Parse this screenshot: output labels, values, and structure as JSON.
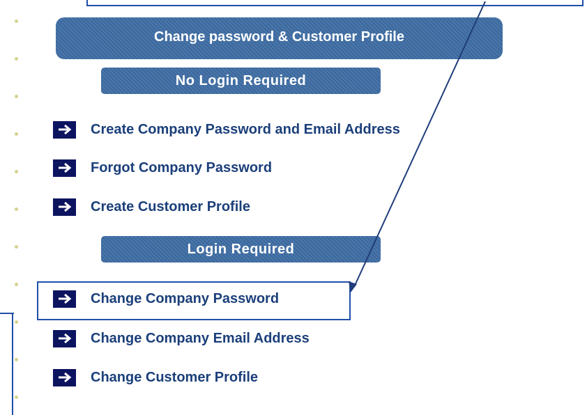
{
  "header": {
    "title": "Change password & Customer Profile"
  },
  "sections": {
    "no_login": "No Login Required",
    "login": "Login Required"
  },
  "no_login_links": [
    {
      "label": "Create Company Password and Email Address",
      "icon": "arrow-right-icon"
    },
    {
      "label": "Forgot Company Password",
      "icon": "arrow-right-icon"
    },
    {
      "label": "Create Customer Profile",
      "icon": "arrow-right-icon"
    }
  ],
  "login_links": [
    {
      "label": "Change Company Password",
      "icon": "arrow-right-icon",
      "highlighted": true
    },
    {
      "label": "Change Company Email Address",
      "icon": "arrow-right-icon"
    },
    {
      "label": "Change Customer Profile",
      "icon": "arrow-right-icon"
    }
  ],
  "colors": {
    "banner": "#3f6ea5",
    "link_text": "#1b3f7a",
    "arrow_box": "#0c1460",
    "callout": "#1f4fa8",
    "rail_dot": "#d6d28e"
  }
}
